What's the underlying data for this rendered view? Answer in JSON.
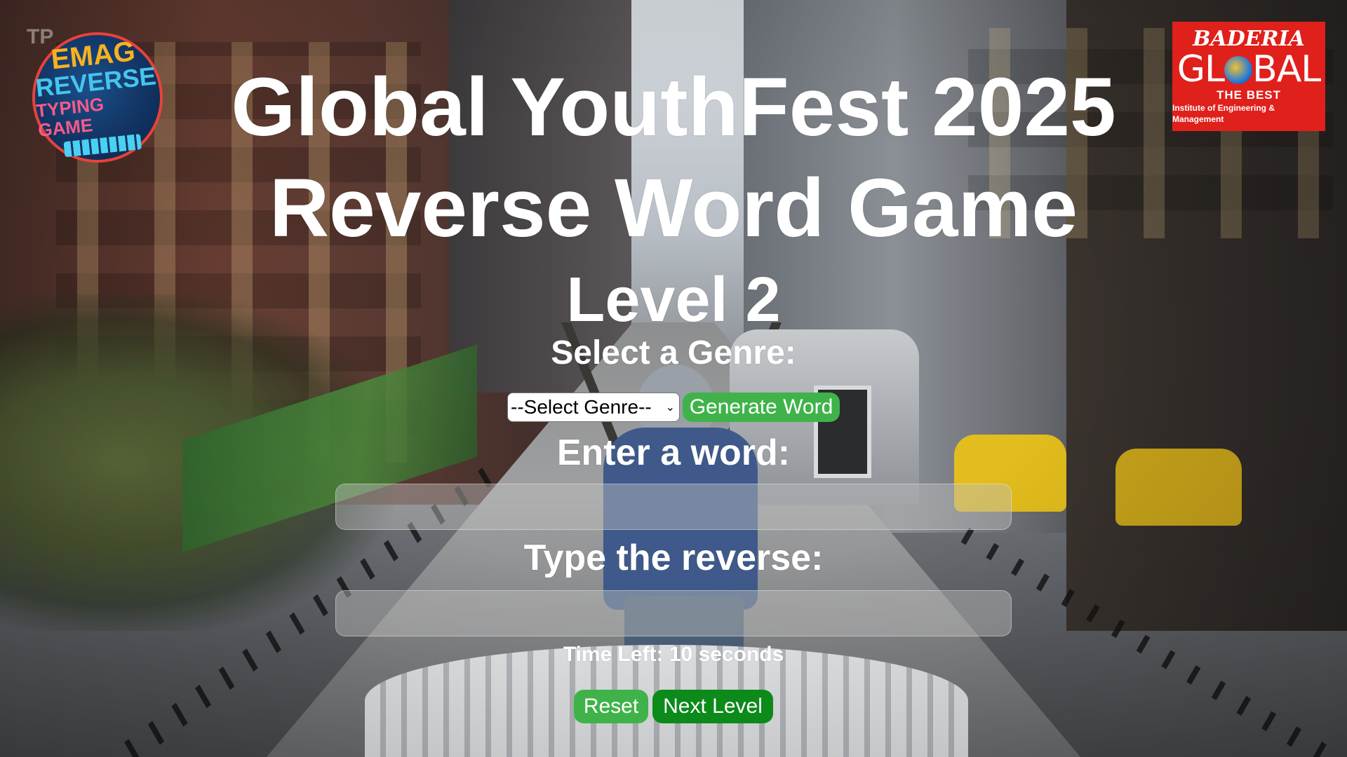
{
  "logos": {
    "left": {
      "line1": "EMAG",
      "line2": "REVERSE",
      "line3": "TYPING GAME"
    },
    "corner_mark": "TP",
    "right": {
      "line1": "BADERIA",
      "line2_a": "GL",
      "line2_b": "BAL",
      "line3": "THE BEST",
      "line4": "Institute of Engineering & Management",
      "color": "#e0201b"
    }
  },
  "header": {
    "title_line1": "Global YouthFest 2025",
    "title_line2": "Reverse Word Game",
    "level": "Level 2"
  },
  "genre": {
    "label": "Select a Genre:",
    "select_value": "--Select Genre--",
    "generate_button": "Generate Word"
  },
  "word_entry": {
    "label": "Enter a word:",
    "value": ""
  },
  "reverse_entry": {
    "label": "Type the reverse:",
    "value": ""
  },
  "timer": {
    "prefix": "Time Left:",
    "value": "10",
    "unit": "seconds"
  },
  "controls": {
    "reset_button": "Reset",
    "next_level_button": "Next Level"
  },
  "colors": {
    "primary_button": "#3fb34a",
    "next_button": "#0c8a1a",
    "text": "#ffffff"
  }
}
